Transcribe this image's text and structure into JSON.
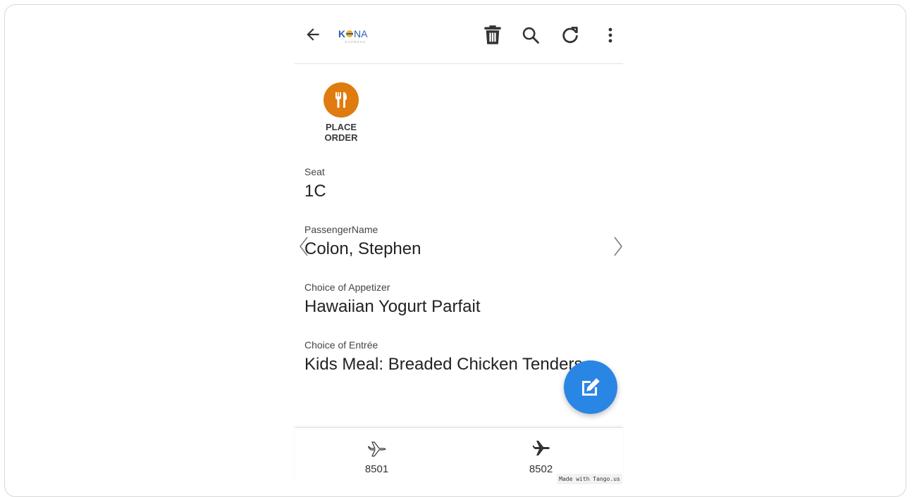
{
  "header": {
    "logo_text": "KONA",
    "logo_subtext": "EXPRESS",
    "icons": [
      "arrow-left-icon",
      "trash-icon",
      "search-icon",
      "refresh-icon",
      "more-vert-icon"
    ]
  },
  "action": {
    "label": "PLACE ORDER",
    "icon": "utensils-icon",
    "color": "#e07b10"
  },
  "fields": {
    "seat": {
      "label": "Seat",
      "value": "1C"
    },
    "passenger": {
      "label": "PassengerName",
      "value": "Colon, Stephen"
    },
    "appetizer": {
      "label": "Choice of Appetizer",
      "value": "Hawaiian Yogurt Parfait"
    },
    "entree": {
      "label": "Choice of Entrée",
      "value": "Kids Meal: Breaded Chicken Tenders"
    }
  },
  "fab": {
    "icon": "edit-icon",
    "color": "#2a86e5"
  },
  "bottom_nav": [
    {
      "label": "8501",
      "icon": "plane-outline-icon"
    },
    {
      "label": "8502",
      "icon": "plane-filled-icon"
    }
  ],
  "watermark": "Made with Tango.us"
}
